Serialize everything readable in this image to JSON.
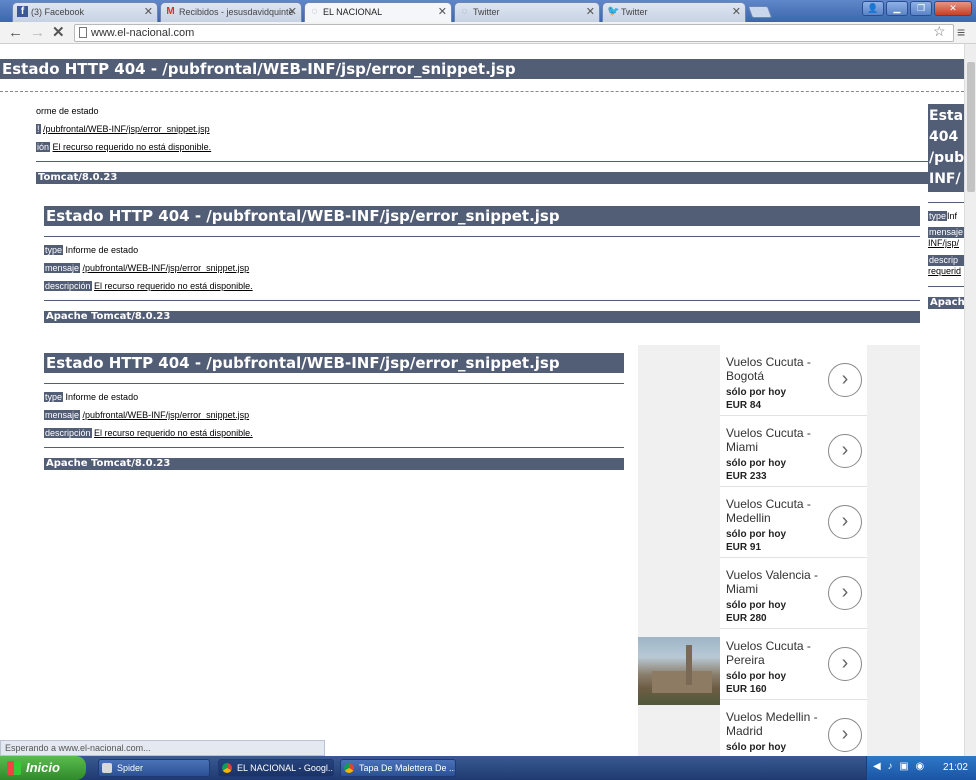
{
  "browser": {
    "tabs": [
      {
        "title": "(3) Facebook",
        "icon": "facebook-icon",
        "active": false
      },
      {
        "title": "Recibidos - jesusdavidquinte",
        "icon": "gmail-icon",
        "active": false
      },
      {
        "title": "EL NACIONAL",
        "icon": "page-icon",
        "active": true
      },
      {
        "title": "Twitter",
        "icon": "page-icon",
        "active": false
      },
      {
        "title": "Twitter",
        "icon": "twitter-icon",
        "active": false
      }
    ],
    "url": "www.el-nacional.com",
    "status": "Esperando a www.el-nacional.com..."
  },
  "error_outer": {
    "heading": "Estado HTTP 404 - /pubfrontal/WEB-INF/jsp/error_snippet.jsp",
    "type_text": "orme de estado",
    "msg_label": "!",
    "msg_text": "/pubfrontal/WEB-INF/jsp/error_snippet.jsp",
    "desc_label": "ión",
    "desc_text": "El recurso requerido no está disponible.",
    "footer": "Tomcat/8.0.23"
  },
  "error_page": {
    "heading": "Estado HTTP 404 - /pubfrontal/WEB-INF/jsp/error_snippet.jsp",
    "type_label": "type",
    "type_text": "Informe de estado",
    "msg_label": "mensaje",
    "msg_text": "/pubfrontal/WEB-INF/jsp/error_snippet.jsp",
    "desc_label": "descripción",
    "desc_text": "El recurso requerido no está disponible.",
    "footer": "Apache Tomcat/8.0.23"
  },
  "error_right": {
    "heading_lines": [
      "Esta",
      "404",
      "/pub",
      "INF/"
    ],
    "type_label": "type",
    "type_text": "Inf",
    "msg_label": "mensaje",
    "msg_text": "INF/jsp/",
    "desc_label": "descrip",
    "desc_text": "requerid",
    "footer": "Apache"
  },
  "ads": [
    {
      "title": "Vuelos Cucuta - Bogotá",
      "line1": "sólo por hoy",
      "price": "EUR 84"
    },
    {
      "title": "Vuelos Cucuta - Miami",
      "line1": "sólo por hoy",
      "price": "EUR 233"
    },
    {
      "title": "Vuelos Cucuta - Medellin",
      "line1": "sólo por hoy",
      "price": "EUR 91"
    },
    {
      "title": "Vuelos Valencia - Miami",
      "line1": "sólo por hoy",
      "price": "EUR 280"
    },
    {
      "title": "Vuelos Cucuta - Pereira",
      "line1": "sólo por hoy",
      "price": "EUR 160"
    },
    {
      "title": "Vuelos Medellin - Madrid",
      "line1": "sólo por hoy",
      "price": ""
    }
  ],
  "taskbar": {
    "start": "Inicio",
    "tasks": [
      "Spider",
      "EL NACIONAL - Googl...",
      "Tapa De Malettera De ..."
    ],
    "clock": "21:02"
  },
  "colors": {
    "tomcat_bar": "#525d76",
    "taskbar": "#1f3a70"
  }
}
